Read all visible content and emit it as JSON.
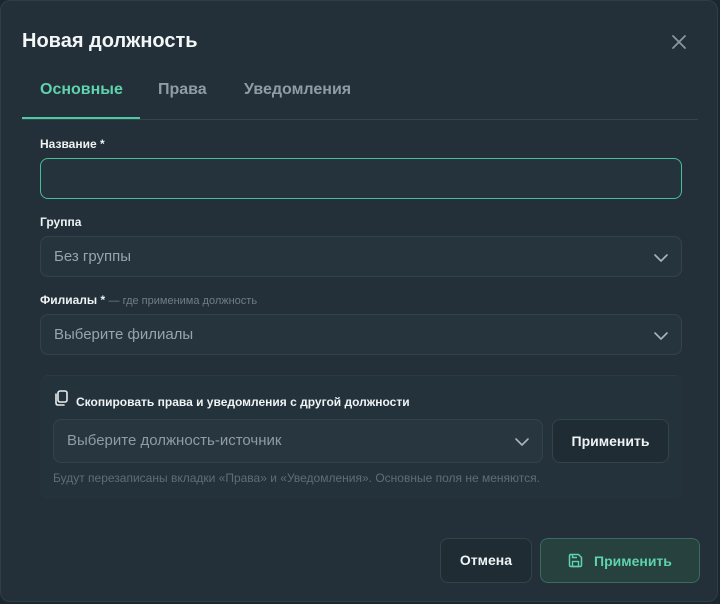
{
  "dialog": {
    "title": "Новая должность"
  },
  "tabs": [
    {
      "label": "Основные",
      "active": true
    },
    {
      "label": "Права",
      "active": false
    },
    {
      "label": "Уведомления",
      "active": false
    }
  ],
  "form": {
    "name_label": "Название *",
    "name_value": "",
    "group_label": "Группа",
    "group_value": "Без группы",
    "branches_label": "Филиалы *",
    "branches_hint": "— где применима должность",
    "branches_placeholder": "Выберите филиалы"
  },
  "copy": {
    "title": "Скопировать права и уведомления с другой должности",
    "source_placeholder": "Выберите должность-источник",
    "apply_label": "Применить",
    "note": "Будут перезаписаны вкладки «Права» и «Уведомления». Основные поля не меняются."
  },
  "footer": {
    "cancel_label": "Отмена",
    "apply_label": "Применить"
  },
  "icons": {
    "close": "close-icon",
    "chevron": "chevron-down-icon",
    "copy": "copy-icon",
    "save": "save-icon"
  },
  "colors": {
    "accent": "#5ed3ac",
    "background": "#233039"
  }
}
